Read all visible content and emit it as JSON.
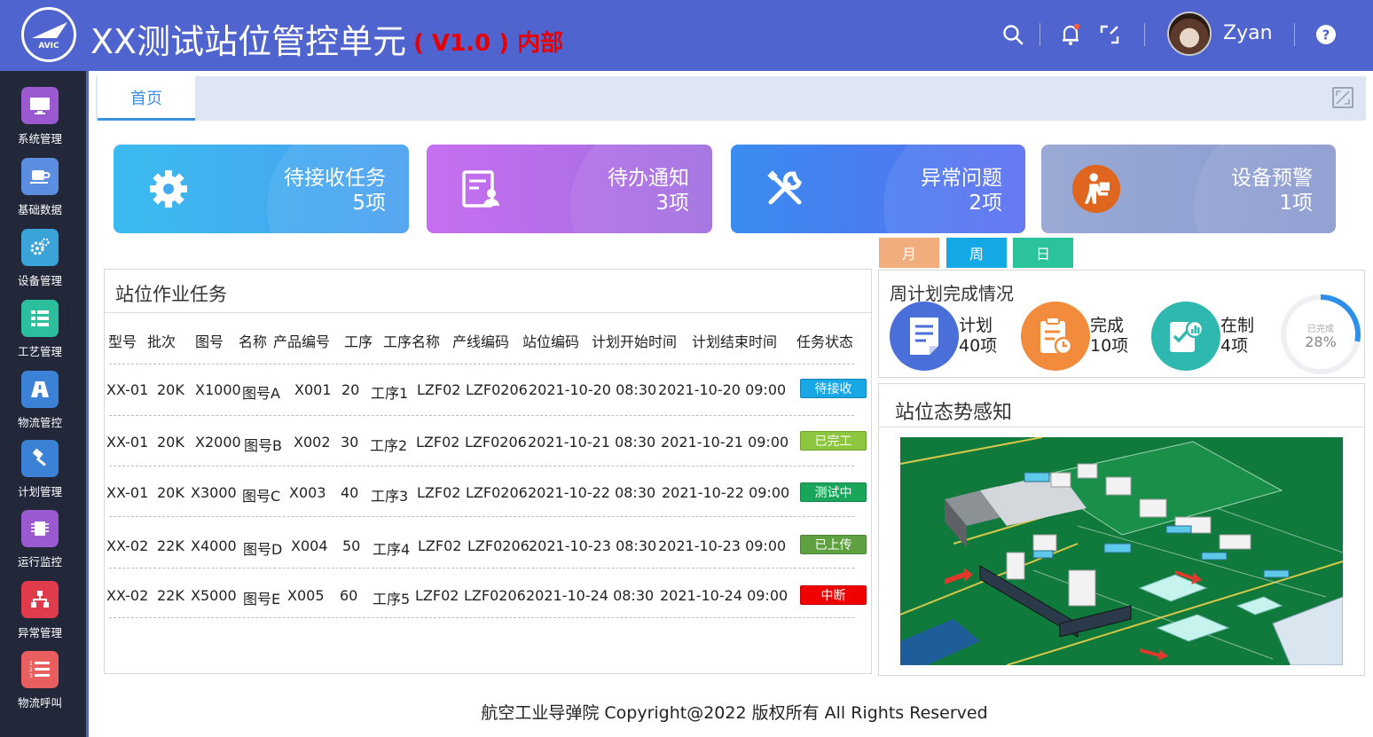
{
  "header": {
    "logo_text": "AVIC",
    "title": "XX测试站位管控单元",
    "version": "( V1.0 ) 内部",
    "username": "Zyan",
    "icons": [
      "search-icon",
      "bell-icon",
      "fullscreen-icon",
      "avatar",
      "help-icon"
    ]
  },
  "sidebar": {
    "items": [
      {
        "label": "系统管理",
        "icon": "monitor-icon",
        "color": "#9b59d0"
      },
      {
        "label": "基础数据",
        "icon": "cup-icon",
        "color": "#5b8de0"
      },
      {
        "label": "设备管理",
        "icon": "gears-icon",
        "color": "#3aa3d8"
      },
      {
        "label": "工艺管理",
        "icon": "list-icon",
        "color": "#2bbf9e"
      },
      {
        "label": "物流管控",
        "icon": "road-icon",
        "color": "#3b82d6"
      },
      {
        "label": "计划管理",
        "icon": "hammer-icon",
        "color": "#3b82d6"
      },
      {
        "label": "运行监控",
        "icon": "chip-icon",
        "color": "#9b59d0"
      },
      {
        "label": "异常管理",
        "icon": "network-icon",
        "color": "#e03b4c"
      },
      {
        "label": "物流呼叫",
        "icon": "numbered-list-icon",
        "color": "#e95e5e"
      }
    ]
  },
  "tabs": {
    "home": "首页"
  },
  "cards": [
    {
      "label": "待接收任务",
      "count": "5项",
      "icon": "gear-icon"
    },
    {
      "label": "待办通知",
      "count": "3项",
      "icon": "contact-card-icon"
    },
    {
      "label": "异常问题",
      "count": "2项",
      "icon": "tools-icon"
    },
    {
      "label": "设备预警",
      "count": "1项",
      "icon": "worker-icon"
    }
  ],
  "period_buttons": [
    "月",
    "周",
    "日"
  ],
  "tasks": {
    "title": "站位作业任务",
    "headers": [
      "型号",
      "批次",
      "图号",
      "名称",
      "产品编号",
      "工序",
      "工序名称",
      "产线编码",
      "站位编码",
      "计划开始时间",
      "计划结束时间",
      "任务状态"
    ],
    "rows": [
      {
        "model": "XX-01",
        "batch": "20K",
        "drawing": "X1000",
        "name": "图号A",
        "product": "X001",
        "proc": "20",
        "proc_name": "工序1",
        "line": "LZF02",
        "station": "LZF0206",
        "start": "2021-10-20 08:30",
        "end": "2021-10-20 09:00",
        "status": "待接收",
        "status_color": "#1aa7e6"
      },
      {
        "model": "XX-01",
        "batch": "20K",
        "drawing": "X2000",
        "name": "图号B",
        "product": "X002",
        "proc": "30",
        "proc_name": "工序2",
        "line": "LZF02",
        "station": "LZF0206",
        "start": "2021-10-21 08:30",
        "end": "2021-10-21 09:00",
        "status": "已完工",
        "status_color": "#8cc63f"
      },
      {
        "model": "XX-01",
        "batch": "20K",
        "drawing": "X3000",
        "name": "图号C",
        "product": "X003",
        "proc": "40",
        "proc_name": "工序3",
        "line": "LZF02",
        "station": "LZF0206",
        "start": "2021-10-22 08:30",
        "end": "2021-10-22 09:00",
        "status": "测试中",
        "status_color": "#19a65b"
      },
      {
        "model": "XX-02",
        "batch": "22K",
        "drawing": "X4000",
        "name": "图号D",
        "product": "X004",
        "proc": "50",
        "proc_name": "工序4",
        "line": "LZF02",
        "station": "LZF0206",
        "start": "2021-10-23 08:30",
        "end": "2021-10-23 09:00",
        "status": "已上传",
        "status_color": "#5fa041"
      },
      {
        "model": "XX-02",
        "batch": "22K",
        "drawing": "X5000",
        "name": "图号E",
        "product": "X005",
        "proc": "60",
        "proc_name": "工序5",
        "line": "LZF02",
        "station": "LZF0206",
        "start": "2021-10-24 08:30",
        "end": "2021-10-24 09:00",
        "status": "中断",
        "status_color": "#f00000"
      }
    ]
  },
  "weekly_plan": {
    "title": "周计划完成情况",
    "items": [
      {
        "label": "计划",
        "value": "40项",
        "icon": "document-icon",
        "color": "#4a6fd8"
      },
      {
        "label": "完成",
        "value": "10项",
        "icon": "clipboard-clock-icon",
        "color": "#f28c3c"
      },
      {
        "label": "在制",
        "value": "4项",
        "icon": "checklist-chart-icon",
        "color": "#2fb8b0"
      }
    ],
    "donut": {
      "caption": "已完成",
      "value_text": "28%",
      "fraction": 0.28
    }
  },
  "situation": {
    "title": "站位态势感知"
  },
  "footer": {
    "text": "航空工业导弹院 Copyright@2022 版权所有 All Rights Reserved"
  }
}
